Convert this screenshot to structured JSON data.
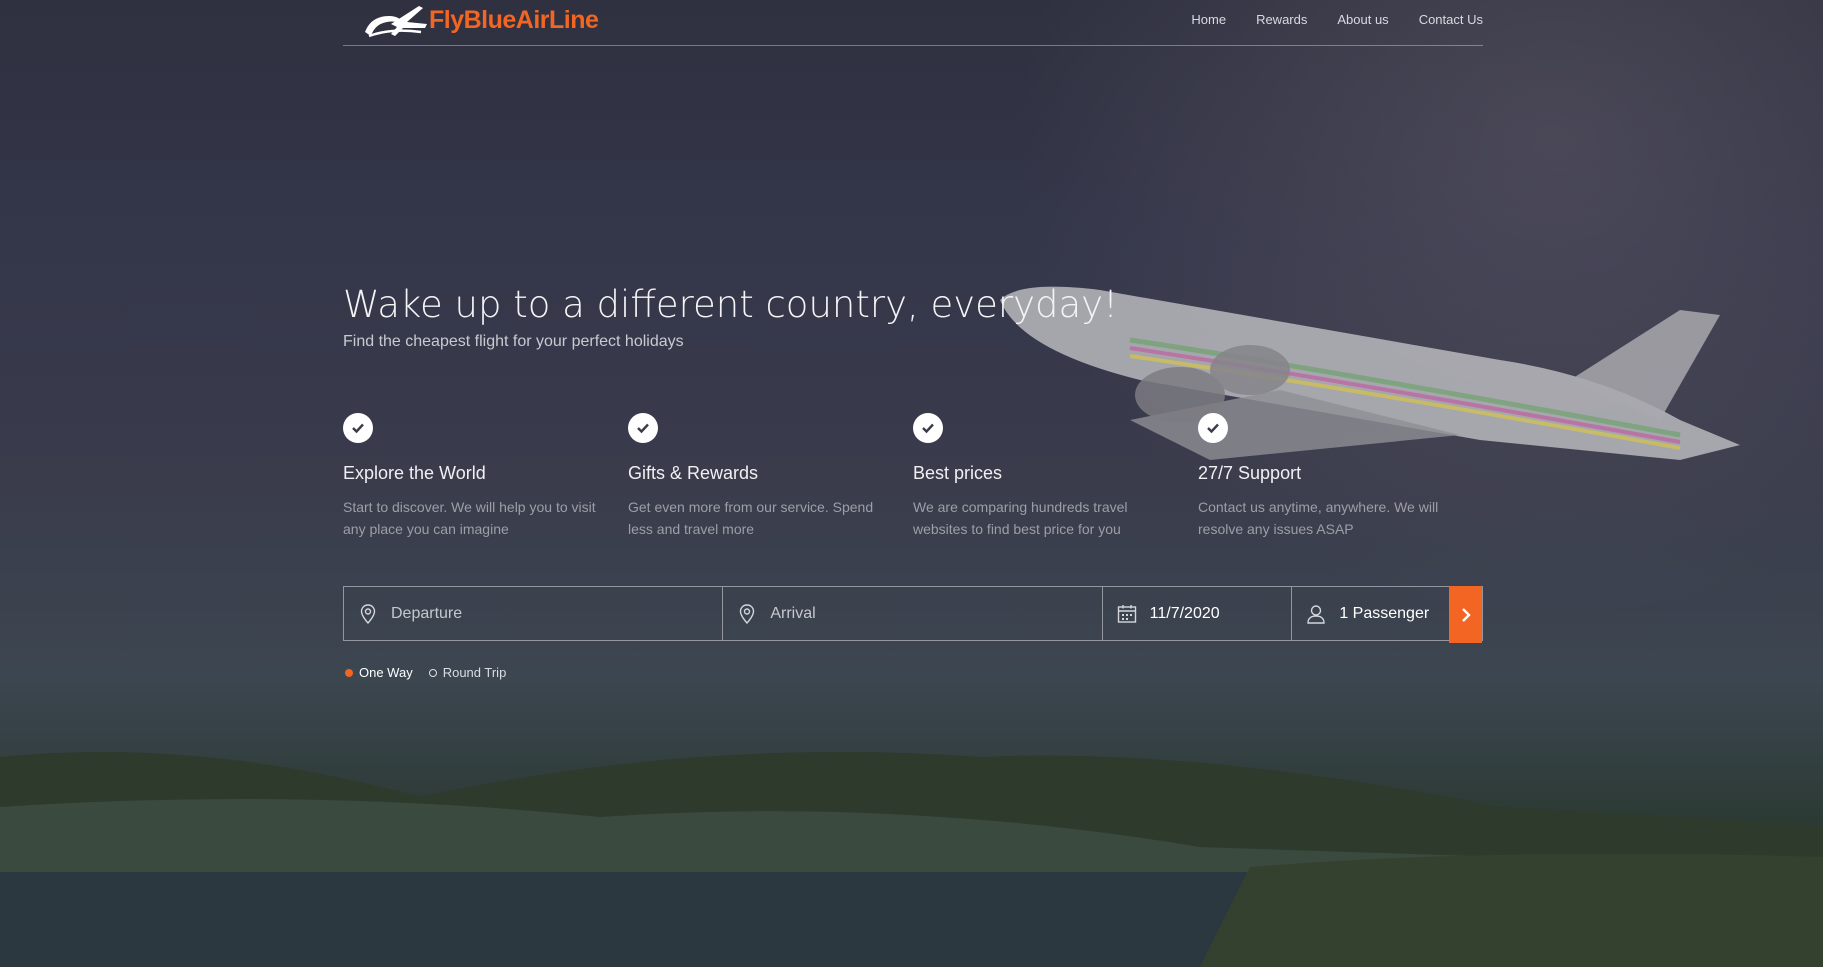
{
  "brand": {
    "name": "FlyBlueAirLine",
    "accent_color": "#f26522",
    "logo_icon": "plane-swoosh-icon"
  },
  "nav": {
    "items": [
      {
        "label": "Home"
      },
      {
        "label": "Rewards"
      },
      {
        "label": "About us"
      },
      {
        "label": "Contact Us"
      }
    ]
  },
  "hero": {
    "title": "Wake up to a different country, everyday!",
    "subtitle": "Find the cheapest flight for your perfect holidays"
  },
  "features": [
    {
      "icon": "check-icon",
      "title": "Explore the World",
      "description": "Start to discover. We will help you to visit any place you can imagine"
    },
    {
      "icon": "check-icon",
      "title": "Gifts & Rewards",
      "description": "Get even more from our service. Spend less and travel more"
    },
    {
      "icon": "check-icon",
      "title": "Best prices",
      "description": "We are comparing hundreds travel websites to find best price for you"
    },
    {
      "icon": "check-icon",
      "title": "27/7 Support",
      "description": "Contact us anytime, anywhere. We will resolve any issues ASAP"
    }
  ],
  "search": {
    "departure": {
      "placeholder": "Departure",
      "value": "",
      "icon": "map-pin-icon"
    },
    "arrival": {
      "placeholder": "Arrival",
      "value": "",
      "icon": "map-pin-icon"
    },
    "date": {
      "value": "11/7/2020",
      "icon": "calendar-icon"
    },
    "passengers": {
      "value": "1 Passenger",
      "icon": "user-icon"
    },
    "submit_icon": "chevron-right-icon"
  },
  "trip_types": {
    "options": [
      {
        "label": "One Way",
        "selected": true
      },
      {
        "label": "Round Trip",
        "selected": false
      }
    ]
  }
}
